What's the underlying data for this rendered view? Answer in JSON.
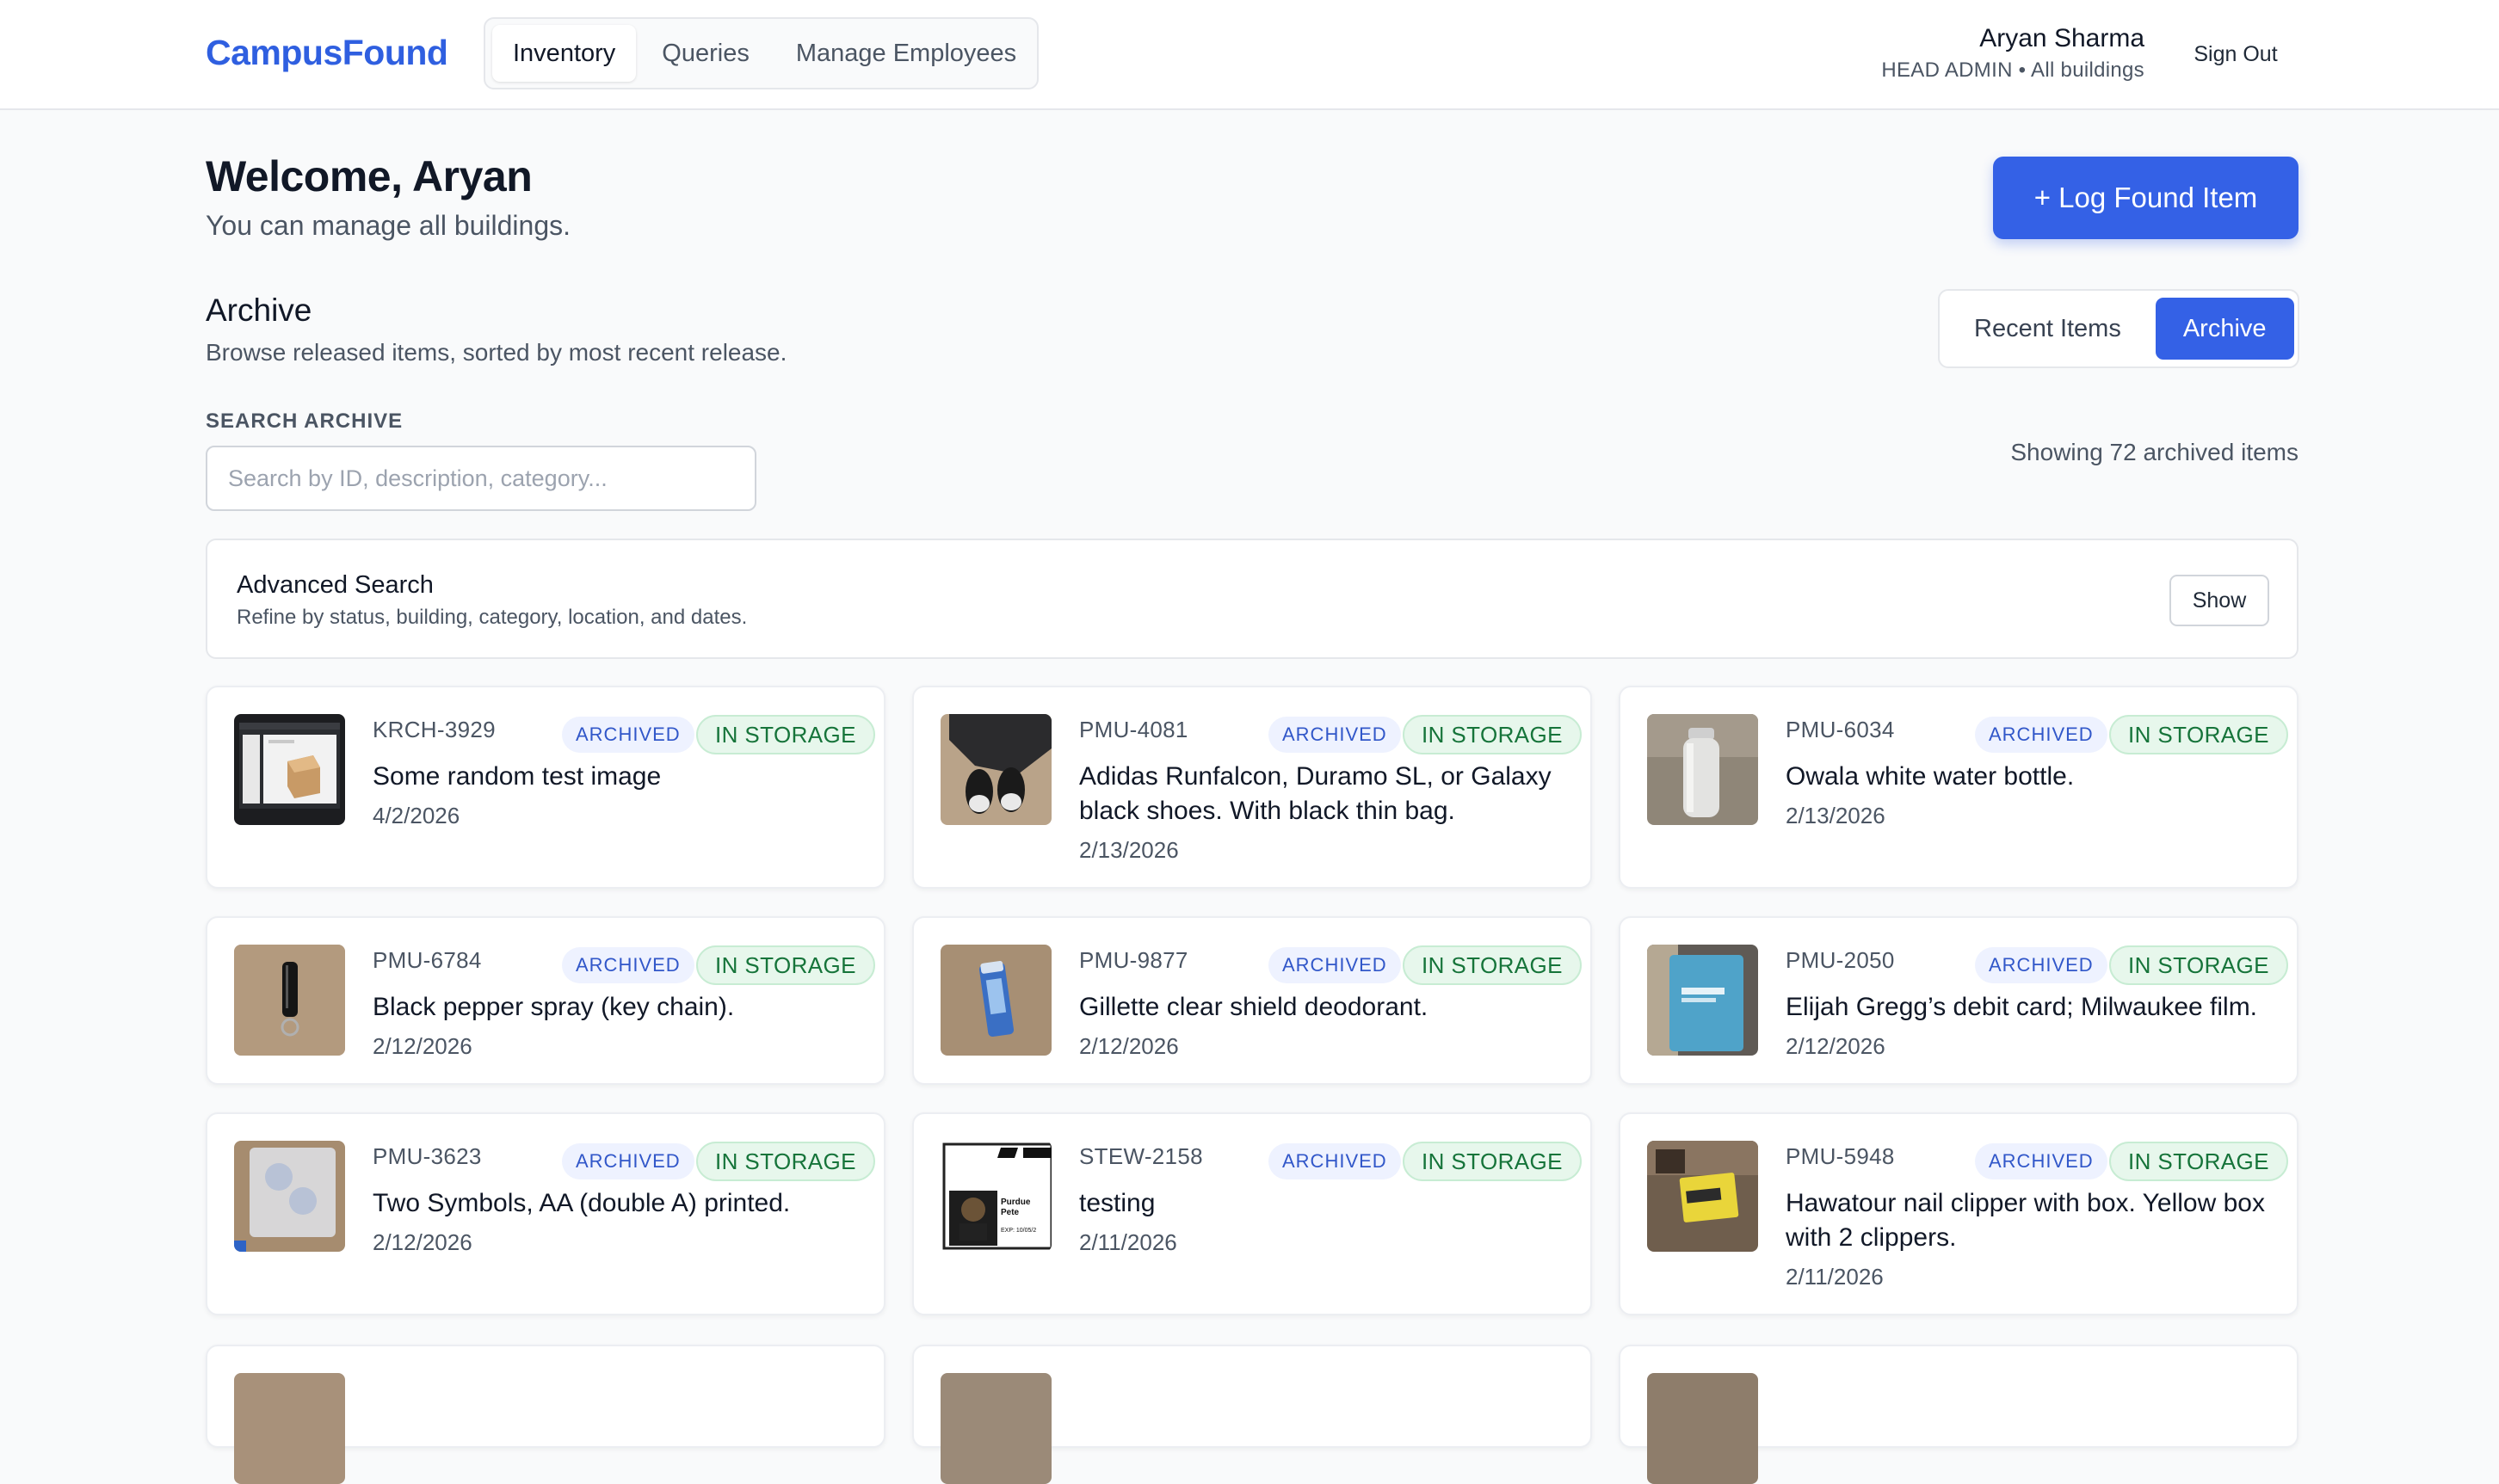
{
  "header": {
    "brand": "CampusFound",
    "nav_tabs": [
      {
        "label": "Inventory",
        "active": true
      },
      {
        "label": "Queries",
        "active": false
      },
      {
        "label": "Manage Employees",
        "active": false
      }
    ],
    "user_name": "Aryan Sharma",
    "user_role": "HEAD ADMIN • All buildings",
    "sign_out": "Sign Out"
  },
  "welcome": {
    "title": "Welcome, Aryan",
    "subtitle": "You can manage all buildings.",
    "log_button": "+ Log Found Item"
  },
  "archive": {
    "title": "Archive",
    "subtitle": "Browse released items, sorted by most recent release.",
    "toggle": [
      {
        "label": "Recent Items",
        "active": false
      },
      {
        "label": "Archive",
        "active": true
      }
    ],
    "search_label": "SEARCH ARCHIVE",
    "search_placeholder": "Search by ID, description, category...",
    "search_value": "",
    "showing": "Showing 72 archived items",
    "advanced": {
      "title": "Advanced Search",
      "subtitle": "Refine by status, building, category, location, and dates.",
      "button": "Show"
    }
  },
  "colors": {
    "accent": "#3461e6",
    "archived_badge_bg": "#eef2ff",
    "storage_badge_bg": "#e7f7ec",
    "storage_badge_text": "#16743a"
  },
  "items": [
    {
      "id": "KRCH-3929",
      "status": "ARCHIVED",
      "location_status": "IN STORAGE",
      "description": "Some random test image",
      "date": "4/2/2026",
      "thumb": "screenshot-photo"
    },
    {
      "id": "PMU-4081",
      "status": "ARCHIVED",
      "location_status": "IN STORAGE",
      "description": "Adidas Runfalcon, Duramo SL, or Galaxy black shoes. With black thin bag.",
      "date": "2/13/2026",
      "thumb": "shoes-photo"
    },
    {
      "id": "PMU-6034",
      "status": "ARCHIVED",
      "location_status": "IN STORAGE",
      "description": "Owala white water bottle.",
      "date": "2/13/2026",
      "thumb": "bottle-photo"
    },
    {
      "id": "PMU-6784",
      "status": "ARCHIVED",
      "location_status": "IN STORAGE",
      "description": "Black pepper spray (key chain).",
      "date": "2/12/2026",
      "thumb": "pepper-spray-photo"
    },
    {
      "id": "PMU-9877",
      "status": "ARCHIVED",
      "location_status": "IN STORAGE",
      "description": "Gillette clear shield deodorant.",
      "date": "2/12/2026",
      "thumb": "deodorant-photo"
    },
    {
      "id": "PMU-2050",
      "status": "ARCHIVED",
      "location_status": "IN STORAGE",
      "description": "Elijah Gregg’s debit card; Milwaukee film.",
      "date": "2/12/2026",
      "thumb": "card-photo"
    },
    {
      "id": "PMU-3623",
      "status": "ARCHIVED",
      "location_status": "IN STORAGE",
      "description": "Two Symbols, AA (double A) printed.",
      "date": "2/12/2026",
      "thumb": "symbols-photo"
    },
    {
      "id": "STEW-2158",
      "status": "ARCHIVED",
      "location_status": "IN STORAGE",
      "description": "testing",
      "date": "2/11/2026",
      "thumb": "id-card-photo",
      "thumb_text": [
        "Purdue",
        "Pete",
        "EXP: 10/05/2"
      ]
    },
    {
      "id": "PMU-5948",
      "status": "ARCHIVED",
      "location_status": "IN STORAGE",
      "description": "Hawatour nail clipper with box. Yellow box with 2 clippers.",
      "date": "2/11/2026",
      "thumb": "nail-clipper-photo"
    }
  ]
}
